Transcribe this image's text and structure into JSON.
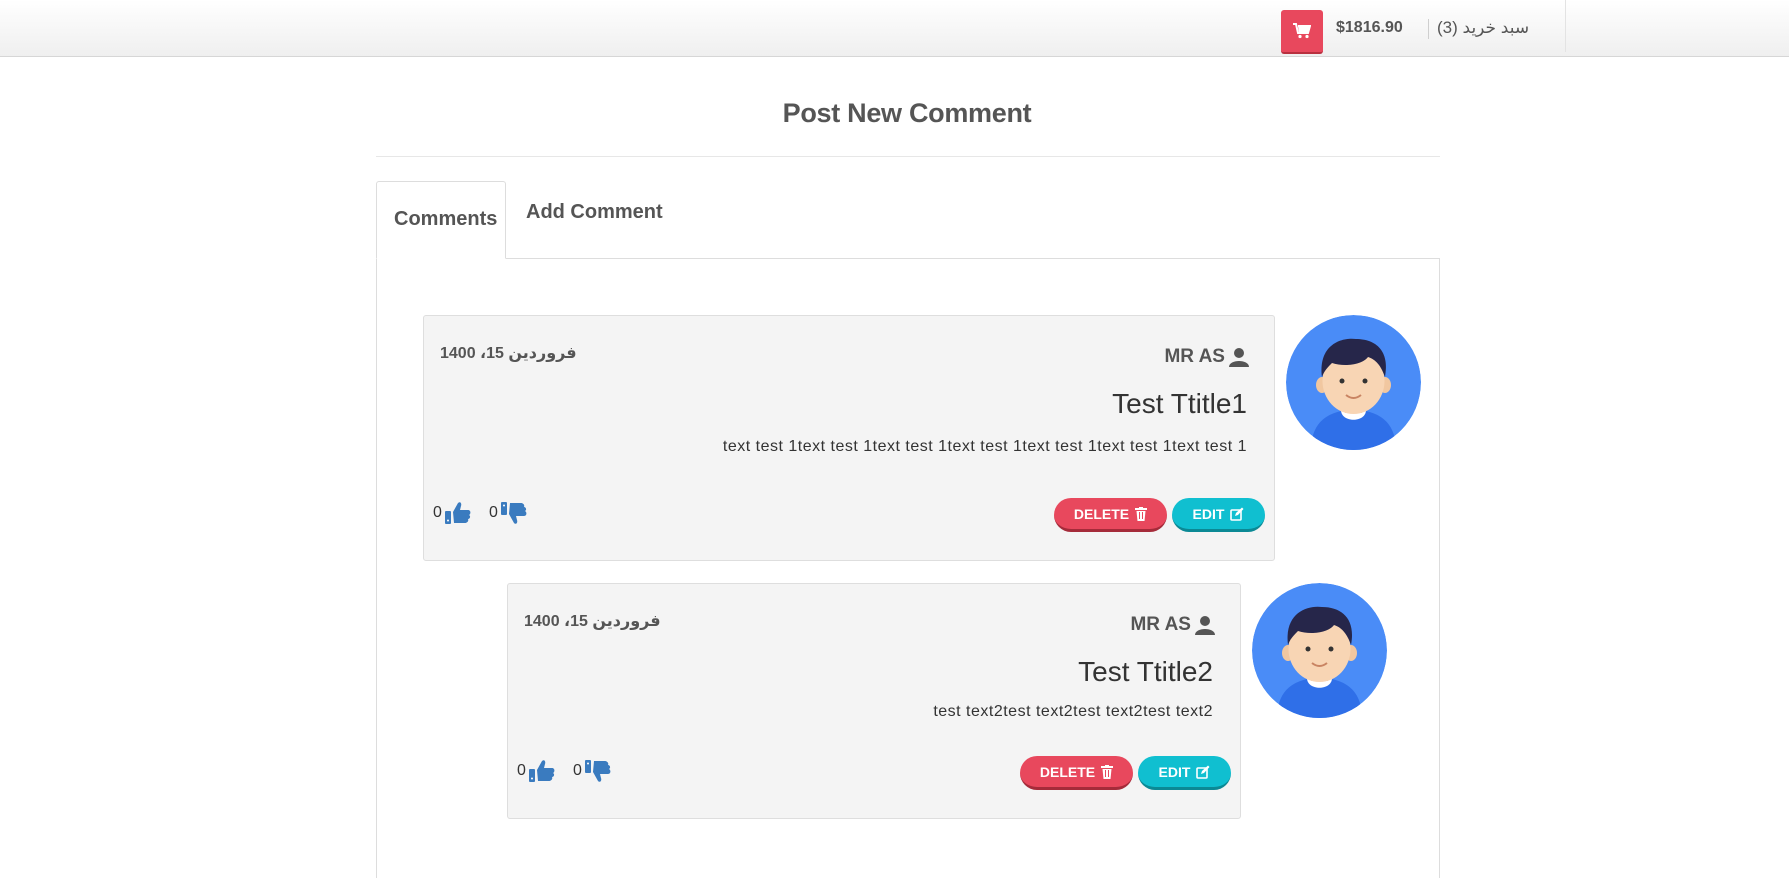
{
  "header": {
    "cart_total": "$1816.90",
    "cart_label": "سبد خرید (3)",
    "cart_icon": "shopping-cart-icon",
    "accent_color": "#e8485d"
  },
  "page": {
    "title": "Post New Comment"
  },
  "tabs": [
    {
      "label": "Comments",
      "active": true
    },
    {
      "label": "Add Comment",
      "active": false
    }
  ],
  "comments": [
    {
      "author": "MR AS",
      "date": "فروردین 15، 1400",
      "title": "Test Ttitle1",
      "text": "text test 1text test 1text test 1text test 1text test 1text test 1text test 1",
      "likes": "0",
      "dislikes": "0",
      "delete_label": "DELETE",
      "edit_label": "EDIT"
    },
    {
      "author": "MR AS",
      "date": "فروردین 15، 1400",
      "title": "Test Ttitle2",
      "text": "test text2test text2test text2test text2",
      "likes": "0",
      "dislikes": "0",
      "delete_label": "DELETE",
      "edit_label": "EDIT"
    }
  ],
  "colors": {
    "delete": "#e8485d",
    "edit": "#10bfd0",
    "vote_icon": "#3a7bbf",
    "avatar_bg": "#4a8cf7"
  }
}
